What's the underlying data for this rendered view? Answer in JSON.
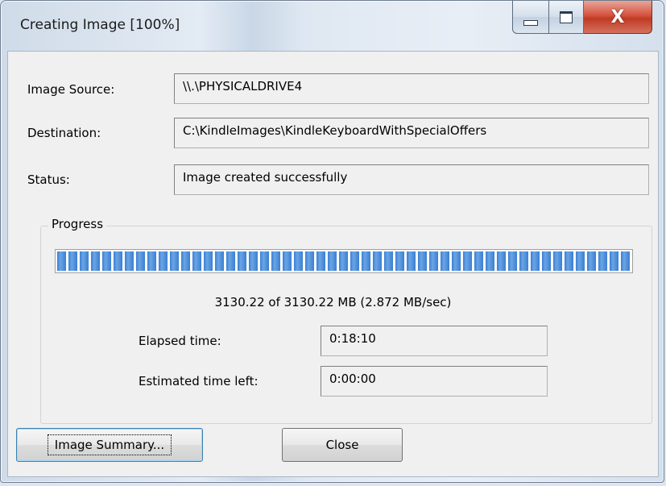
{
  "window": {
    "title": "Creating Image [100%]",
    "controls": {
      "minimize_icon": "minimize-icon",
      "maximize_icon": "maximize-icon",
      "close_glyph": "X"
    }
  },
  "fields": {
    "source_label": "Image Source:",
    "source_value": "\\\\.\\PHYSICALDRIVE4",
    "destination_label": "Destination:",
    "destination_value": "C:\\KindleImages\\KindleKeyboardWithSpecialOffers",
    "status_label": "Status:",
    "status_value": "Image created successfully"
  },
  "progress": {
    "group_title": "Progress",
    "fraction": 1.0,
    "summary": "3130.22 of 3130.22 MB (2.872 MB/sec)",
    "elapsed_label": "Elapsed time:",
    "elapsed_value": "0:18:10",
    "remaining_label": "Estimated time left:",
    "remaining_value": "0:00:00"
  },
  "buttons": {
    "summary_label": "Image Summary...",
    "close_label": "Close"
  },
  "colors": {
    "progress_blue": "#3b7fd1",
    "close_button_red": "#c03a24",
    "dialog_bg": "#f0f0f0"
  }
}
